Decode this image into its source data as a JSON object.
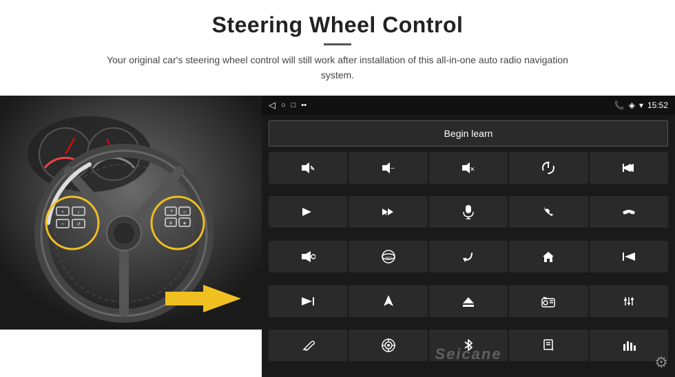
{
  "page": {
    "title": "Steering Wheel Control",
    "divider": true,
    "subtitle": "Your original car's steering wheel control will still work after installation of this all-in-one auto radio navigation system."
  },
  "status_bar": {
    "nav_back": "◁",
    "nav_home": "○",
    "nav_square": "□",
    "battery_signal": "▪▪",
    "phone_icon": "📞",
    "location_icon": "◈",
    "wifi_icon": "▾",
    "time": "15:52"
  },
  "begin_learn": {
    "label": "Begin learn"
  },
  "controls": [
    {
      "icon": "🔊+",
      "label": "vol up"
    },
    {
      "icon": "🔊−",
      "label": "vol down"
    },
    {
      "icon": "🔇",
      "label": "mute"
    },
    {
      "icon": "⏻",
      "label": "power"
    },
    {
      "icon": "⏮",
      "label": "prev track phone"
    },
    {
      "icon": "⏭",
      "label": "next"
    },
    {
      "icon": "⏭✂",
      "label": "fast forward"
    },
    {
      "icon": "🎤",
      "label": "mic"
    },
    {
      "icon": "📞",
      "label": "call"
    },
    {
      "icon": "↩",
      "label": "hang up"
    },
    {
      "icon": "📢",
      "label": "horn"
    },
    {
      "icon": "360°",
      "label": "360"
    },
    {
      "icon": "↺",
      "label": "back"
    },
    {
      "icon": "⌂",
      "label": "home"
    },
    {
      "icon": "⏮⏮",
      "label": "rewind"
    },
    {
      "icon": "⏭⏭",
      "label": "fast fwd2"
    },
    {
      "icon": "▶",
      "label": "nav"
    },
    {
      "icon": "⊖",
      "label": "eject"
    },
    {
      "icon": "📻",
      "label": "radio"
    },
    {
      "icon": "≡↕",
      "label": "settings eq"
    },
    {
      "icon": "✏",
      "label": "pen"
    },
    {
      "icon": "🎯",
      "label": "target"
    },
    {
      "icon": "✱",
      "label": "bluetooth"
    },
    {
      "icon": "♪",
      "label": "music"
    },
    {
      "icon": "📊",
      "label": "equalizer"
    }
  ],
  "watermark": {
    "text": "Seicane"
  },
  "gear_icon": "⚙"
}
